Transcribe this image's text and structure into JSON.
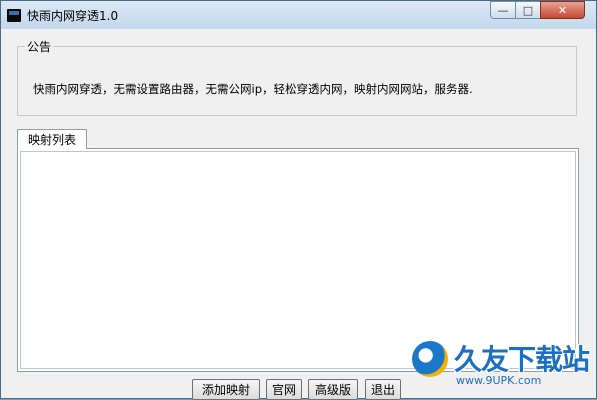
{
  "window": {
    "title": "快雨内网穿透1.0",
    "controls": {
      "minimize": "—",
      "maximize": "□",
      "close": "✕"
    }
  },
  "notice": {
    "group_title": "公告",
    "text": "快雨内网穿透，无需设置路由器，无需公网ip，轻松穿透内网，映射内网网站，服务器."
  },
  "mapping": {
    "tab_label": "映射列表",
    "items": []
  },
  "buttons": {
    "add_mapping": "添加映射",
    "official_site": "官网",
    "advanced": "高级版",
    "exit": "退出"
  },
  "watermark": {
    "brand": "久友下载站",
    "url": "www.9UPK.com"
  },
  "colors": {
    "titlebar": "#c3d8ec",
    "window_bg": "#f0f0f0",
    "close_button": "#c64a34",
    "watermark": "#1d6fc4"
  }
}
